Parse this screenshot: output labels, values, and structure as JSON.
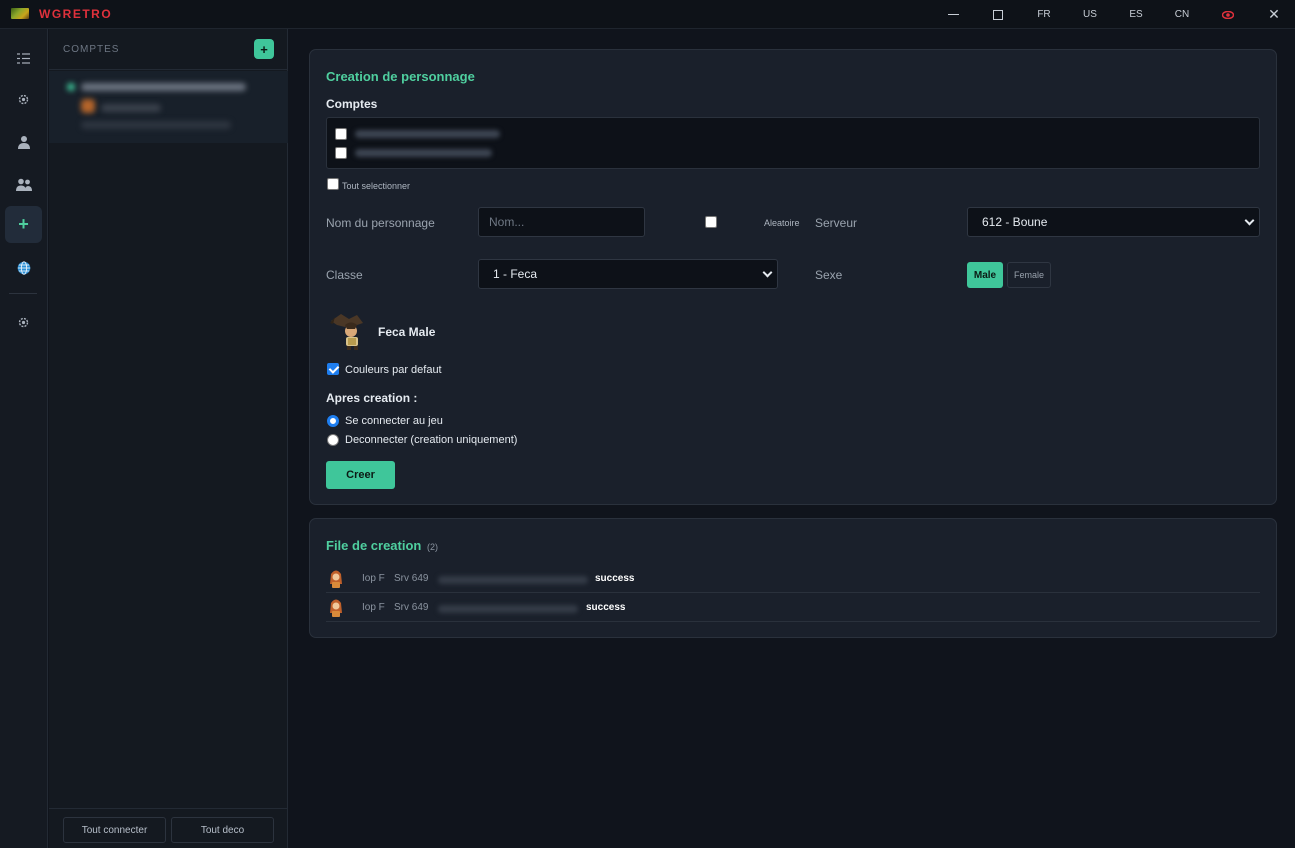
{
  "app": {
    "title": "WGRETRO"
  },
  "titlebar": {
    "languages": [
      "FR",
      "US",
      "ES",
      "CN"
    ],
    "close": "✕"
  },
  "rail": {
    "items": [
      "list-icon",
      "settings-icon",
      "character-icon",
      "group-icon",
      "plus-icon",
      "globe-icon",
      "gear-icon"
    ]
  },
  "accounts": {
    "title": "COMPTES",
    "add": "+",
    "connect_all": "Tout connecter",
    "disconnect_all": "Tout deco"
  },
  "create": {
    "title": "Creation de personnage",
    "accounts_label": "Comptes",
    "select_all": "Tout selectionner",
    "name_label": "Nom du personnage",
    "name_placeholder": "Nom...",
    "random_label": "Aleatoire",
    "server_label": "Serveur",
    "server_value": "612 - Boune",
    "class_label": "Classe",
    "class_value": "1 - Feca",
    "sex_label": "Sexe",
    "male": "Male",
    "female": "Female",
    "preview_name": "Feca Male",
    "default_colors": "Couleurs par defaut",
    "after_label": "Apres creation :",
    "opt_connect": "Se connecter au jeu",
    "opt_disconnect": "Deconnecter (creation uniquement)",
    "submit": "Creer"
  },
  "queue": {
    "title": "File de creation",
    "count": "(2)",
    "rows": [
      {
        "class": "Iop F",
        "server": "Srv 649",
        "status": "success"
      },
      {
        "class": "Iop F",
        "server": "Srv 649",
        "status": "success"
      }
    ]
  },
  "colors": {
    "accent": "#3fc69a",
    "brand": "#e0313c"
  }
}
